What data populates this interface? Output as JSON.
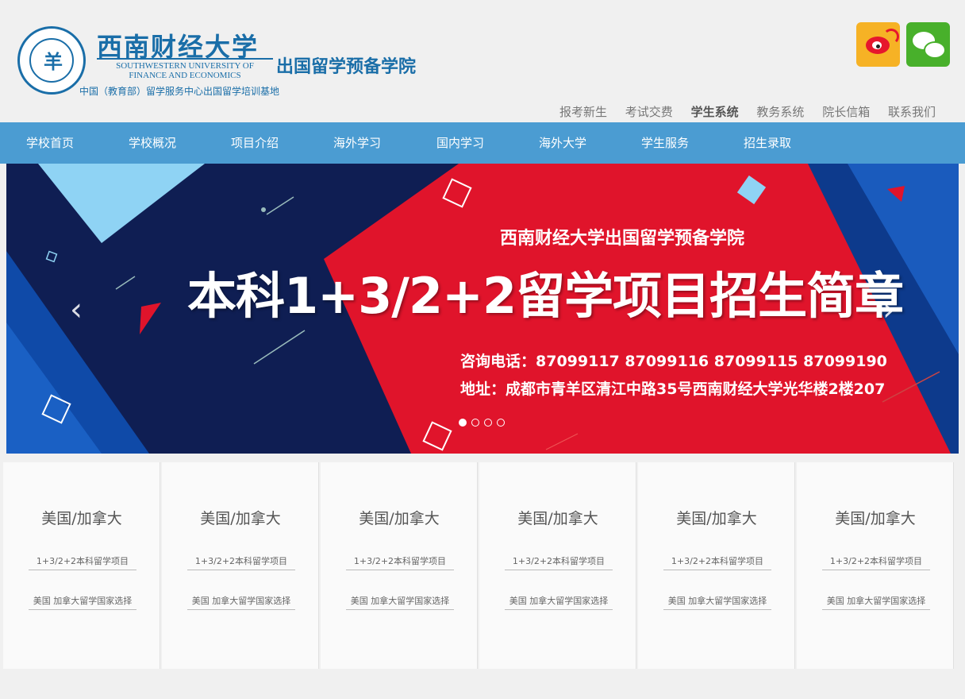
{
  "header": {
    "university_cn": "西南财经大学",
    "university_en_line1": "SOUTHWESTERN UNIVERSITY OF",
    "university_en_line2": "FINANCE AND ECONOMICS",
    "college_name": "出国留学预备学院",
    "subtitle": "中国（教育部）留学服务中心出国留学培训基地",
    "social": [
      "weibo-icon",
      "wechat-icon"
    ],
    "top_links": [
      "报考新生",
      "考试交费",
      "学生系统",
      "教务系统",
      "院长信箱",
      "联系我们"
    ]
  },
  "nav": {
    "items": [
      "学校首页",
      "学校概况",
      "项目介绍",
      "海外学习",
      "国内学习",
      "海外大学",
      "学生服务",
      "招生录取"
    ]
  },
  "banner": {
    "title_small": "西南财经大学出国留学预备学院",
    "title_large": "本科1+3/2+2留学项目招生简章",
    "phone": "咨询电话：87099117 87099116 87099115 87099190",
    "address": "地址：成都市青羊区清江中路35号西南财经大学光华楼2楼207",
    "slide_count": 4,
    "active_slide": 1,
    "colors": {
      "navy": "#0f1e53",
      "red": "#e0142b",
      "light_blue": "#8fd3f4"
    }
  },
  "cards": [
    {
      "title": "美国/加拿大",
      "line1": "1+3/2+2本科留学项目",
      "line2": "美国 加拿大留学国家选择"
    },
    {
      "title": "美国/加拿大",
      "line1": "1+3/2+2本科留学项目",
      "line2": "美国 加拿大留学国家选择"
    },
    {
      "title": "美国/加拿大",
      "line1": "1+3/2+2本科留学项目",
      "line2": "美国 加拿大留学国家选择"
    },
    {
      "title": "美国/加拿大",
      "line1": "1+3/2+2本科留学项目",
      "line2": "美国 加拿大留学国家选择"
    },
    {
      "title": "美国/加拿大",
      "line1": "1+3/2+2本科留学项目",
      "line2": "美国 加拿大留学国家选择"
    },
    {
      "title": "美国/加拿大",
      "line1": "1+3/2+2本科留学项目",
      "line2": "美国 加拿大留学国家选择"
    }
  ]
}
